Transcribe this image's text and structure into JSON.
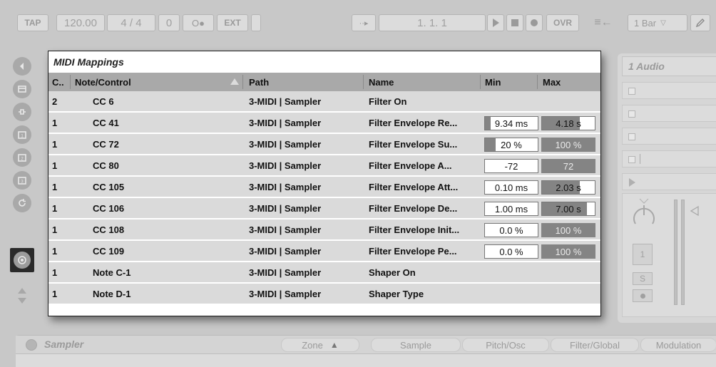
{
  "transport": {
    "tap": "TAP",
    "tempo": "120.00",
    "signature": "4 / 4",
    "groove": "0",
    "metronome": "O●",
    "ext": "EXT",
    "follow": "··▸",
    "position": "1.   1.   1",
    "ovr": "OVR",
    "quantize": "1 Bar",
    "quantize_arrow": "▽"
  },
  "midi_mappings": {
    "title": "MIDI Mappings",
    "columns": [
      "C..",
      "Note/Control",
      "Path",
      "Name",
      "Min",
      "Max"
    ],
    "rows": [
      {
        "ch": "2",
        "control": "CC 6",
        "path": "3-MIDI | Sampler",
        "name": "Filter On",
        "min": "",
        "max": "",
        "min_fill": null,
        "max_fill": null
      },
      {
        "ch": "1",
        "control": "CC 41",
        "path": "3-MIDI | Sampler",
        "name": "Filter Envelope Re...",
        "min": "9.34 ms",
        "max": "4.18 s",
        "min_fill": 0.11,
        "max_fill": 0.72
      },
      {
        "ch": "1",
        "control": "CC 72",
        "path": "3-MIDI | Sampler",
        "name": "Filter Envelope Su...",
        "min": "20 %",
        "max": "100 %",
        "min_fill": 0.2,
        "max_fill": 1.0
      },
      {
        "ch": "1",
        "control": "CC 80",
        "path": "3-MIDI | Sampler",
        "name": "Filter Envelope A...",
        "min": "-72",
        "max": "72",
        "min_fill": 0.0,
        "max_fill": 1.0
      },
      {
        "ch": "1",
        "control": "CC 105",
        "path": "3-MIDI | Sampler",
        "name": "Filter Envelope Att...",
        "min": "0.10 ms",
        "max": "2.03 s",
        "min_fill": 0.0,
        "max_fill": 0.72
      },
      {
        "ch": "1",
        "control": "CC 106",
        "path": "3-MIDI | Sampler",
        "name": "Filter Envelope De...",
        "min": "1.00 ms",
        "max": "7.00 s",
        "min_fill": 0.0,
        "max_fill": 0.85
      },
      {
        "ch": "1",
        "control": "CC 108",
        "path": "3-MIDI | Sampler",
        "name": "Filter Envelope Init...",
        "min": "0.0 %",
        "max": "100 %",
        "min_fill": 0.0,
        "max_fill": 1.0
      },
      {
        "ch": "1",
        "control": "CC 109",
        "path": "3-MIDI | Sampler",
        "name": "Filter Envelope Pe...",
        "min": "0.0 %",
        "max": "100 %",
        "min_fill": 0.0,
        "max_fill": 1.0
      },
      {
        "ch": "1",
        "control": "Note C-1",
        "path": "3-MIDI | Sampler",
        "name": "Shaper On",
        "min": "",
        "max": "",
        "min_fill": null,
        "max_fill": null
      },
      {
        "ch": "1",
        "control": "Note D-1",
        "path": "3-MIDI | Sampler",
        "name": "Shaper Type",
        "min": "",
        "max": "",
        "min_fill": null,
        "max_fill": null
      }
    ]
  },
  "track": {
    "title": "1 Audio",
    "track_number": "1",
    "solo": "S"
  },
  "device": {
    "title": "Sampler",
    "tabs": [
      "Zone",
      "Sample",
      "Pitch/Osc",
      "Filter/Global",
      "Modulation"
    ],
    "zone_arrow": "▲"
  },
  "colors": {
    "background": "#c8c8c8",
    "header": "#a9a9a9",
    "row": "#dadada",
    "value_fill": "#848484"
  }
}
